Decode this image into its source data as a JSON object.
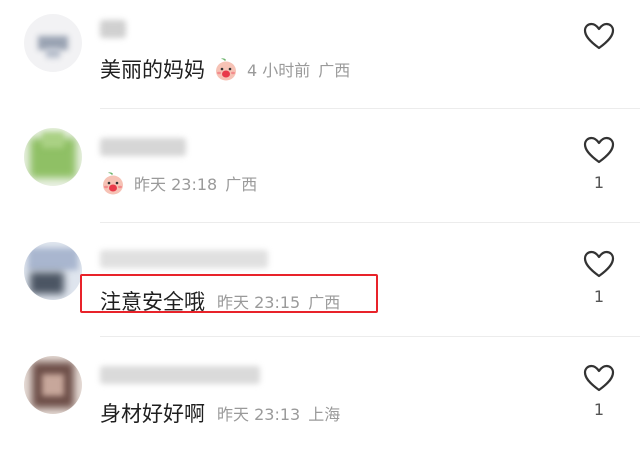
{
  "comments": [
    {
      "text": "美丽的妈妈",
      "has_sticker": true,
      "time": "4 小时前",
      "location": "广西",
      "likes": ""
    },
    {
      "text": "",
      "has_sticker": true,
      "time": "昨天 23:18",
      "location": "广西",
      "likes": "1"
    },
    {
      "text": "注意安全哦",
      "has_sticker": false,
      "time": "昨天 23:15",
      "location": "广西",
      "likes": "1"
    },
    {
      "text": "身材好好啊",
      "has_sticker": false,
      "time": "昨天 23:13",
      "location": "上海",
      "likes": "1"
    }
  ],
  "colors": {
    "highlight_border": "#e8232a",
    "meta_text": "#9a9a9a",
    "body_text": "#1f1f1f"
  },
  "icons": {
    "like": "heart-outline-icon",
    "sticker": "peach-emoji-icon"
  }
}
